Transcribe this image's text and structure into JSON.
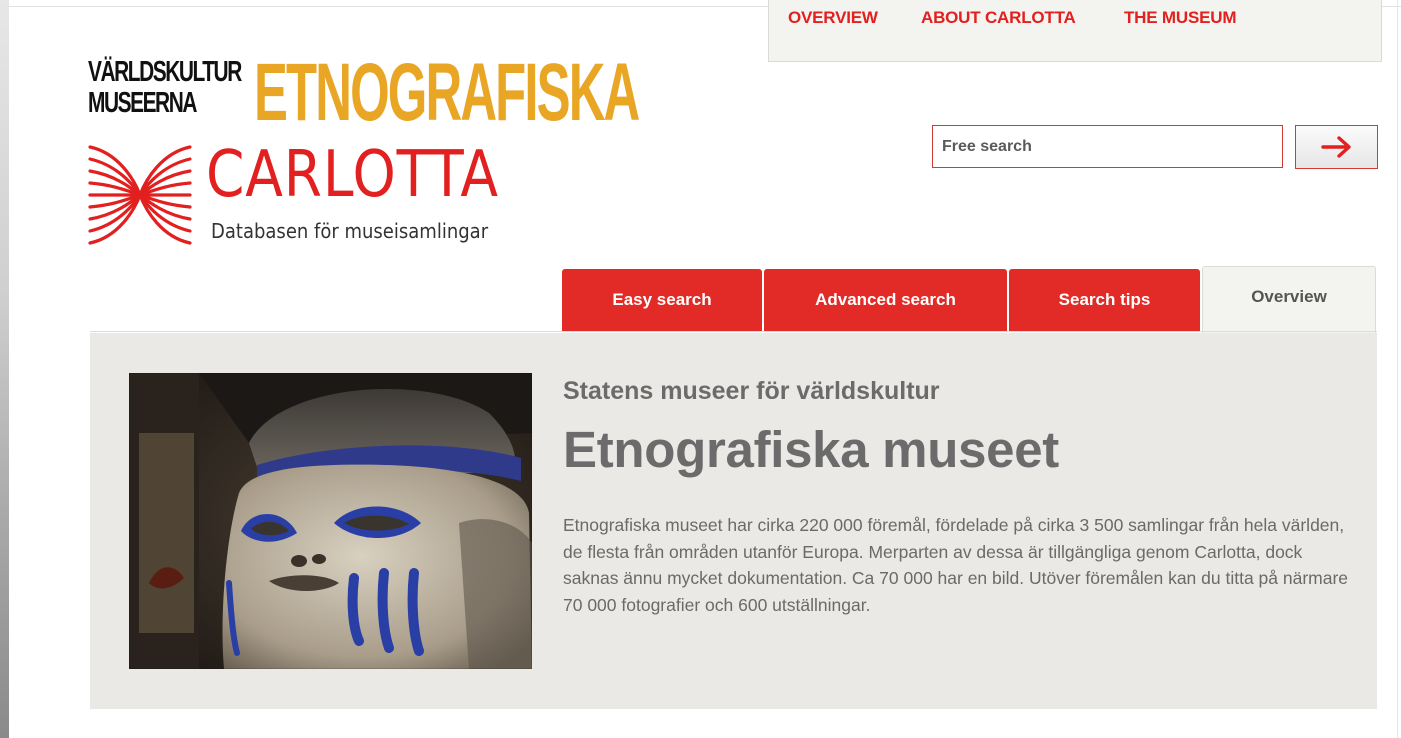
{
  "nav": {
    "overview": "OVERVIEW",
    "about": "ABOUT CARLOTTA",
    "museum": "THE MUSEUM"
  },
  "logo": {
    "line1": "VÄRLDSKULTUR",
    "line2": "MUSEERNA",
    "museum_name": "ETNOGRAFISKA",
    "product_name": "CARLOTTA",
    "tagline": "Databasen för museisamlingar",
    "icon": "carlotta-swirl-icon"
  },
  "search": {
    "placeholder": "Free search",
    "value": "",
    "button_icon": "arrow-right-icon"
  },
  "tabs": [
    {
      "label": "Easy search",
      "active": false
    },
    {
      "label": "Advanced search",
      "active": false
    },
    {
      "label": "Search tips",
      "active": false
    },
    {
      "label": "Overview",
      "active": true
    }
  ],
  "content": {
    "image": "museum-mask-photo",
    "kicker": "Statens museer för världskultur",
    "headline": "Etnografiska museet",
    "body": "Etnografiska museet har cirka 220 000 föremål, fördelade på cirka 3 500 samlingar från hela världen, de flesta från områden utanför Europa. Merparten av dessa är tillgängliga genom Carlotta, dock saknas ännu mycket dokumentation. Ca 70 000 har en bild. Utöver föremålen kan du titta på närmare 70 000 fotografier och 600 utställningar."
  },
  "colors": {
    "brand_red": "#e1201f",
    "brand_gold": "#e8a624",
    "panel_bg": "#ebe9e6",
    "text_grey": "#6b6b6b"
  }
}
